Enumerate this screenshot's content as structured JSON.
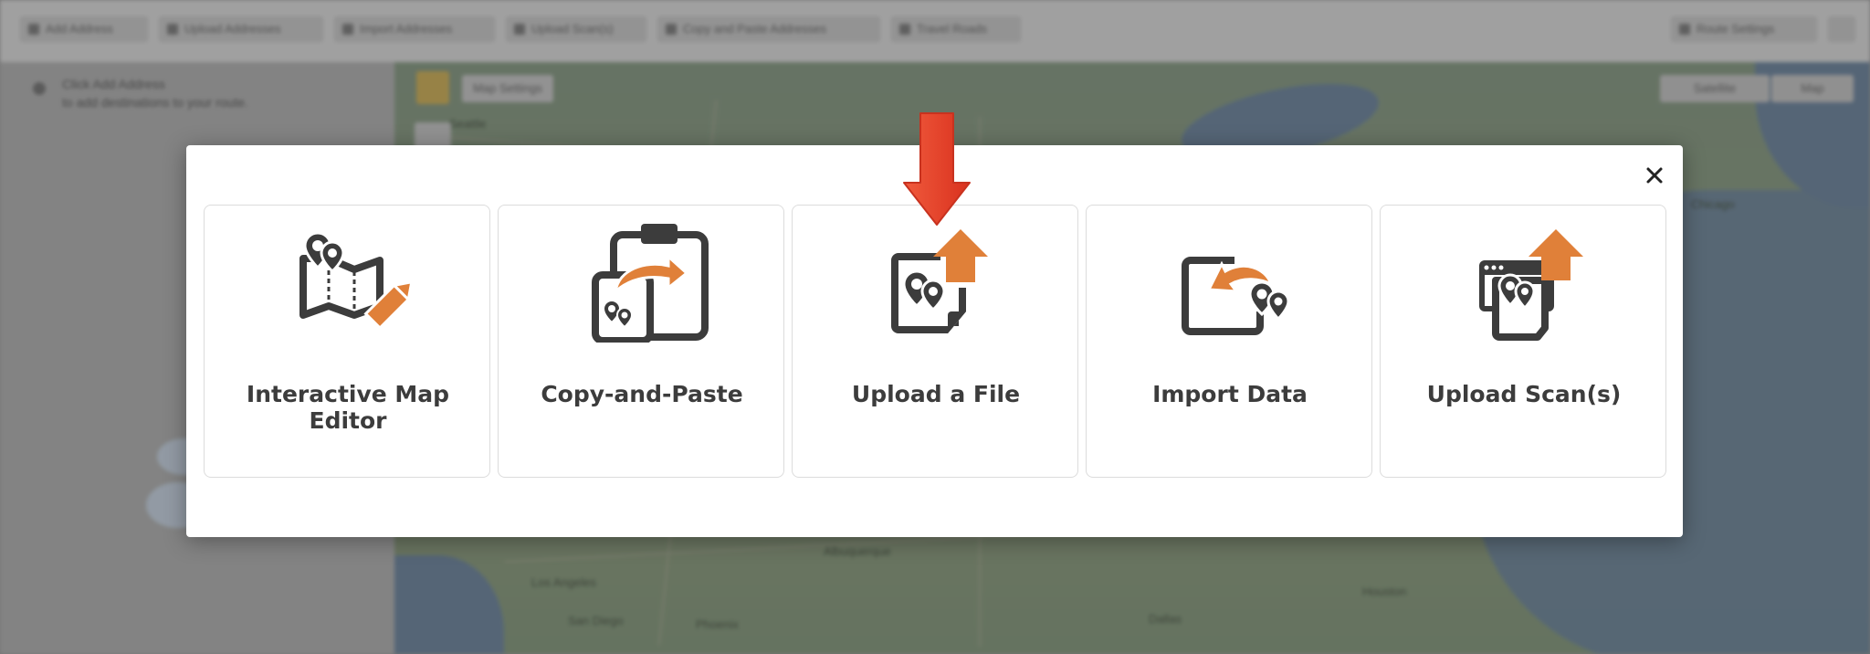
{
  "colors": {
    "accent": "#e08039",
    "icon_dark": "#3c3c3c",
    "annotation_arrow": "#e8412c"
  },
  "toolbar": {
    "buttons": [
      {
        "label": "Add Address",
        "icon": "plus-icon"
      },
      {
        "label": "Upload Addresses",
        "icon": "upload-icon"
      },
      {
        "label": "Import Addresses",
        "icon": "import-icon"
      },
      {
        "label": "Upload Scan(s)",
        "icon": "scan-icon"
      },
      {
        "label": "Copy and Paste Addresses",
        "icon": "paste-icon"
      },
      {
        "label": "Travel Roads",
        "icon": "truck-icon"
      },
      {
        "label": "Route Settings",
        "icon": "gear-icon"
      }
    ]
  },
  "sidebar": {
    "hint_line1": "Click Add Address",
    "hint_line2": "to add destinations to your route."
  },
  "map": {
    "settings_label": "Map Settings",
    "map_type_1": "Satellite",
    "map_type_2": "Map",
    "labels": [
      "Los Angeles",
      "San Diego",
      "Phoenix",
      "Albuquerque",
      "Dallas",
      "Houston",
      "Seattle",
      "Chicago"
    ]
  },
  "modal": {
    "close_icon": "close-icon",
    "options": [
      {
        "label": "Interactive Map Editor",
        "icon": "map-editor-icon"
      },
      {
        "label": "Copy-and-Paste",
        "icon": "clipboard-paste-icon"
      },
      {
        "label": "Upload a File",
        "icon": "file-upload-icon"
      },
      {
        "label": "Import Data",
        "icon": "import-data-icon"
      },
      {
        "label": "Upload Scan(s)",
        "icon": "scan-upload-icon"
      }
    ]
  }
}
